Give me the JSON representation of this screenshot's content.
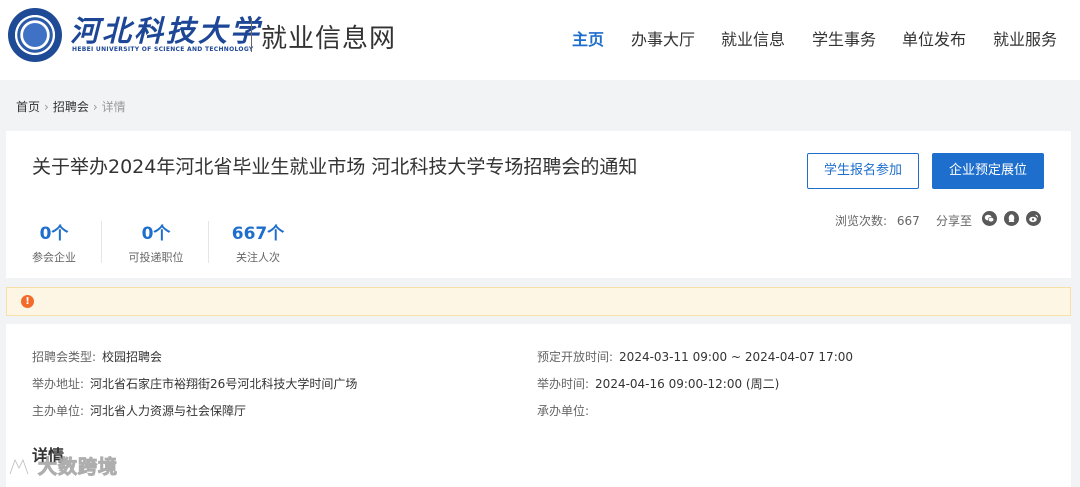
{
  "header": {
    "school_cn": "河北科技大学",
    "school_en": "HEBEI UNIVERSITY OF SCIENCE AND TECHNOLOGY",
    "site_name": "就业信息网",
    "nav": [
      {
        "label": "主页",
        "active": true
      },
      {
        "label": "办事大厅",
        "active": false
      },
      {
        "label": "就业信息",
        "active": false
      },
      {
        "label": "学生事务",
        "active": false
      },
      {
        "label": "单位发布",
        "active": false
      },
      {
        "label": "就业服务",
        "active": false
      }
    ]
  },
  "breadcrumb": [
    "首页",
    "招聘会",
    "详情"
  ],
  "fair": {
    "title": "关于举办2024年河北省毕业生就业市场 河北科技大学专场招聘会的通知",
    "stats": [
      {
        "value": "0个",
        "label": "参会企业"
      },
      {
        "value": "0个",
        "label": "可投递职位"
      },
      {
        "value": "667个",
        "label": "关注人次"
      }
    ],
    "student_button": "学生报名参加",
    "company_button": "企业预定展位",
    "views_label": "浏览次数:",
    "views_value": "667",
    "share_label": "分享至",
    "share_icons": [
      "wechat-icon",
      "qq-icon",
      "weibo-icon"
    ]
  },
  "alert": {
    "icon": "warning-icon",
    "text": ""
  },
  "info": {
    "type_label": "招聘会类型:",
    "type_value": "校园招聘会",
    "address_label": "举办地址:",
    "address_value": "河北省石家庄市裕翔街26号河北科技大学时间广场",
    "host_label": "主办单位:",
    "host_value": "河北省人力资源与社会保障厅",
    "booking_label": "预定开放时间:",
    "booking_value": "2024-03-11 09:00 ~ 2024-04-07 17:00",
    "time_label": "举办时间:",
    "time_value": "2024-04-16 09:00-12:00 (周二)",
    "organizer_label": "承办单位:",
    "organizer_value": "",
    "detail_heading": "详情"
  },
  "watermark": "大数跨境",
  "colors": {
    "primary": "#1e6ecd",
    "school_blue": "#1d4796",
    "alert_bg": "#fdf6e4",
    "alert_icon": "#f36b2b"
  }
}
